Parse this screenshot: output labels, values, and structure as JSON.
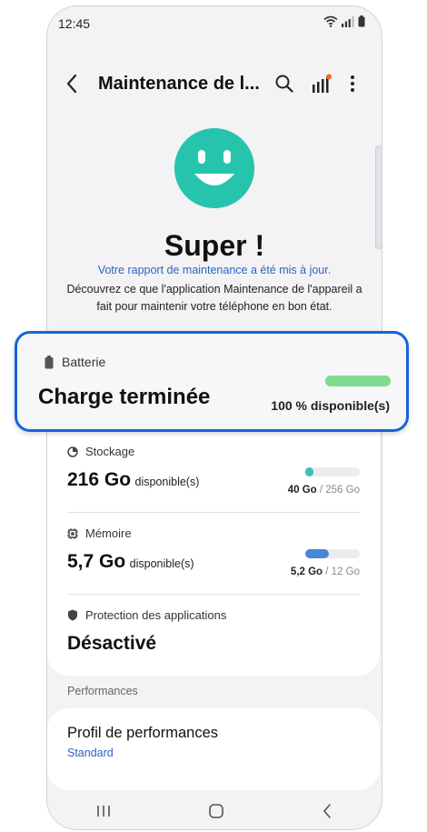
{
  "status_bar": {
    "time": "12:45"
  },
  "app_bar": {
    "title": "Maintenance de l..."
  },
  "result": {
    "headline": "Super !",
    "report_link": "Votre rapport de maintenance a été mis à jour.",
    "description": "Découvrez ce que l'application Maintenance de l'appareil a fait pour maintenir votre téléphone en bon état."
  },
  "battery": {
    "label": "Batterie",
    "status": "Charge terminée",
    "available": "100 % disponible(s)",
    "level": 1.0
  },
  "storage": {
    "label": "Stockage",
    "value": "216 Go",
    "suffix": "disponible(s)",
    "used": "40 Go",
    "separator": " / ",
    "total": "256 Go",
    "used_fraction": 0.156
  },
  "memory": {
    "label": "Mémoire",
    "value": "5,7 Go",
    "suffix": "disponible(s)",
    "used": "5,2 Go",
    "separator": " / ",
    "total": "12 Go",
    "used_fraction": 0.433
  },
  "app_protection": {
    "label": "Protection des applications",
    "value": "Désactivé"
  },
  "performance": {
    "section_label": "Performances",
    "profile_title": "Profil de performances",
    "profile_value": "Standard"
  },
  "colors": {
    "accent": "#1565d8",
    "link": "#2b63c8",
    "smile": "#27c4ad",
    "battery_fill": "#7fdc8e",
    "storage_fill": "#3fbfb6",
    "memory_fill": "#4a86d8",
    "notification_dot": "#f36b2b"
  }
}
